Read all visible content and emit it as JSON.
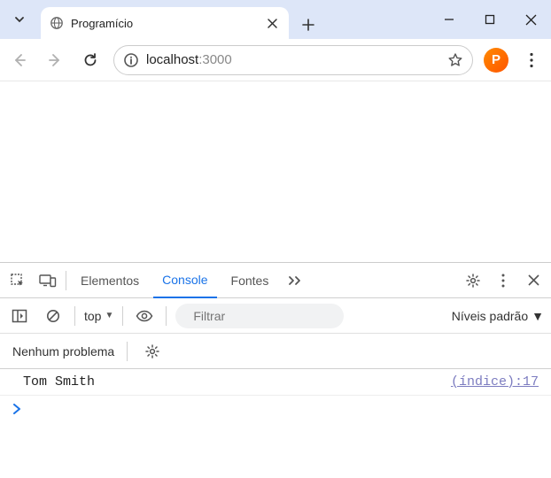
{
  "tab": {
    "title": "Programício"
  },
  "url": {
    "scheme": "localhost",
    "port": ":3000"
  },
  "devtools": {
    "tabs": {
      "elements": "Elementos",
      "console": "Console",
      "sources": "Fontes"
    },
    "context": "top",
    "filter_placeholder": "Filtrar",
    "levels": "Níveis padrão",
    "issues": "Nenhum problema",
    "log": {
      "message": "Tom Smith",
      "source": "(índice):17"
    }
  },
  "extension_letter": "P"
}
